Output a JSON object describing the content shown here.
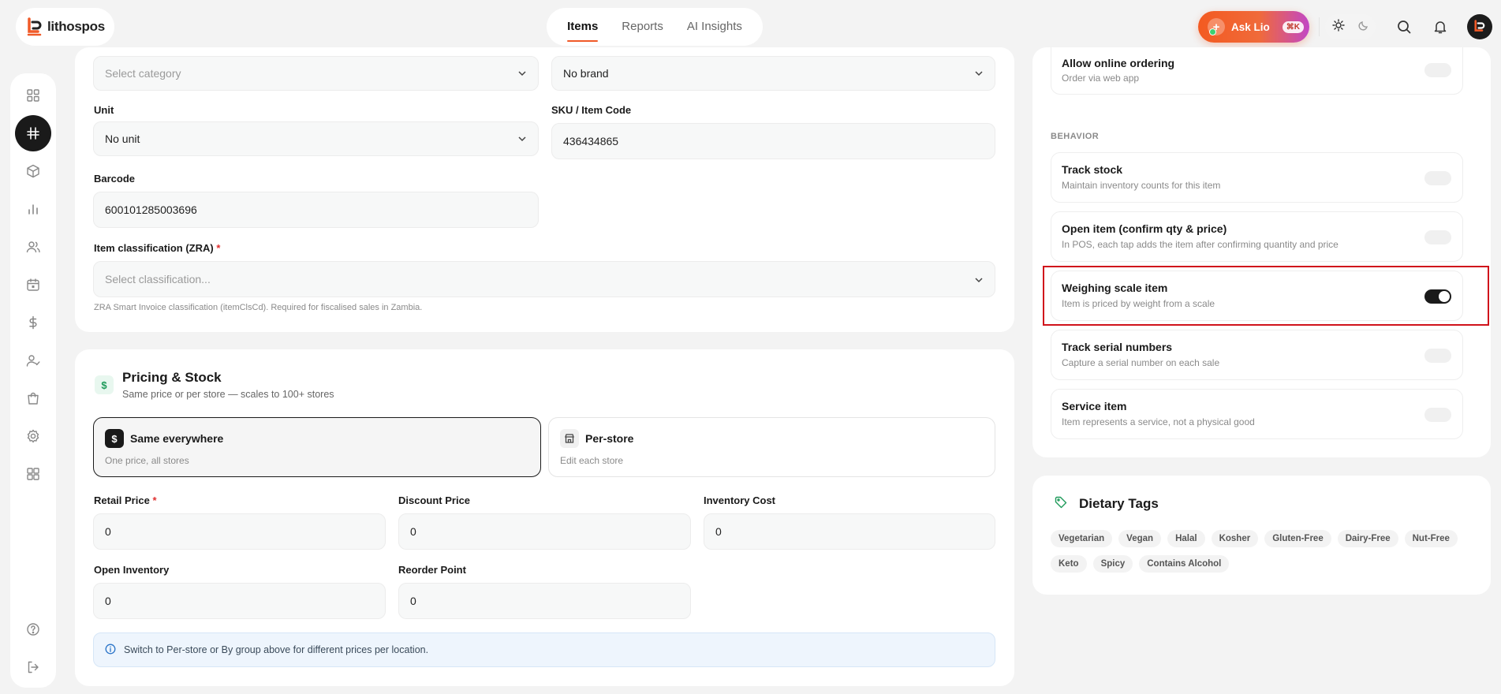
{
  "app": {
    "logo_text": "lithospos"
  },
  "nav": {
    "tabs": [
      {
        "label": "Items"
      },
      {
        "label": "Reports"
      },
      {
        "label": "AI Insights"
      }
    ]
  },
  "header": {
    "ask_label": "Ask Lio",
    "ask_shortcut": "⌘K"
  },
  "form": {
    "category": {
      "placeholder": "Select category"
    },
    "brand": {
      "value": "No brand"
    },
    "unit": {
      "label": "Unit",
      "value": "No unit"
    },
    "sku": {
      "label": "SKU / Item Code",
      "value": "436434865"
    },
    "barcode": {
      "label": "Barcode",
      "value": "600101285003696"
    },
    "classification": {
      "label": "Item classification (ZRA)",
      "required_mark": "*",
      "placeholder": "Select classification...",
      "hint": "ZRA Smart Invoice classification (itemClsCd). Required for fiscalised sales in Zambia."
    }
  },
  "pricing": {
    "title": "Pricing & Stock",
    "subtitle": "Same price or per store — scales to 100+ stores",
    "options": [
      {
        "title": "Same everywhere",
        "desc": "One price, all stores",
        "selected": true
      },
      {
        "title": "Per-store",
        "desc": "Edit each store",
        "selected": false
      }
    ],
    "fields": {
      "retail_price": {
        "label": "Retail Price",
        "required_mark": "*",
        "value": "0"
      },
      "discount_price": {
        "label": "Discount Price",
        "value": "0"
      },
      "inventory_cost": {
        "label": "Inventory Cost",
        "value": "0"
      },
      "open_inventory": {
        "label": "Open Inventory",
        "value": "0"
      },
      "reorder_point": {
        "label": "Reorder Point",
        "value": "0"
      }
    },
    "info": "Switch to Per-store or By group above for different prices per location."
  },
  "settings": {
    "online": {
      "title": "Allow online ordering",
      "desc": "Order via web app",
      "on": false
    },
    "behavior_heading": "BEHAVIOR",
    "behavior": [
      {
        "title": "Track stock",
        "desc": "Maintain inventory counts for this item",
        "on": false
      },
      {
        "title": "Open item (confirm qty & price)",
        "desc": "In POS, each tap adds the item after confirming quantity and price",
        "on": false
      },
      {
        "title": "Weighing scale item",
        "desc": "Item is priced by weight from a scale",
        "on": true
      },
      {
        "title": "Track serial numbers",
        "desc": "Capture a serial number on each sale",
        "on": false
      },
      {
        "title": "Service item",
        "desc": "Item represents a service, not a physical good",
        "on": false
      }
    ]
  },
  "dietary": {
    "title": "Dietary Tags",
    "tags": [
      "Vegetarian",
      "Vegan",
      "Halal",
      "Kosher",
      "Gluten-Free",
      "Dairy-Free",
      "Nut-Free",
      "Keto",
      "Spicy",
      "Contains Alcohol"
    ]
  },
  "colors": {
    "accent": "#f05a28",
    "highlight": "#d0121b",
    "dark": "#1a1a1a"
  }
}
